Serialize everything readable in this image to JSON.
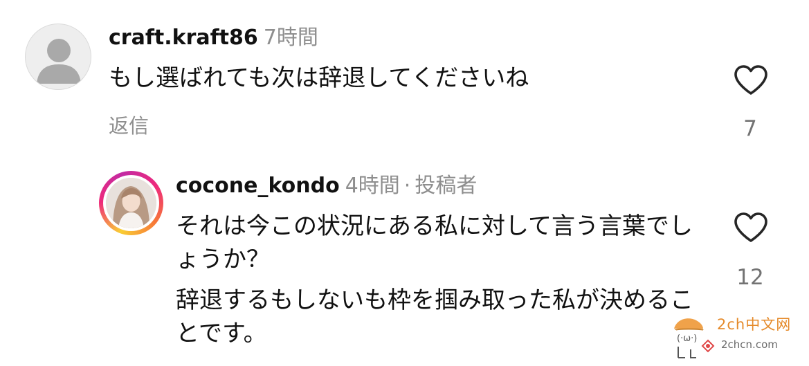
{
  "comments": [
    {
      "username": "craft.kraft86",
      "time": "7時間",
      "text": "もし選ばれても次は辞退してくださいね",
      "reply_label": "返信",
      "like_count": "7",
      "avatar_icon": "default-avatar-icon",
      "like_icon": "heart-outline-icon"
    },
    {
      "username": "cocone_kondo",
      "time": "4時間",
      "separator": "·",
      "badge": "投稿者",
      "text_paragraphs": [
        "それは今この状況にある私に対して言う言葉でしょうか？",
        "辞退するもしないも枠を掴み取った私が決めることです。"
      ],
      "like_count": "12",
      "avatar_icon": "story-ring-avatar",
      "like_icon": "heart-outline-icon"
    }
  ],
  "watermark": {
    "title": "2ch中文网",
    "url": "2chcn.com"
  },
  "colors": {
    "text": "#111111",
    "secondary": "#8e8e8e",
    "story_ring": [
      "#f9ce34",
      "#ee2a7b",
      "#c32aa3",
      "#f77737"
    ],
    "watermark_title": "#e58a2a"
  }
}
